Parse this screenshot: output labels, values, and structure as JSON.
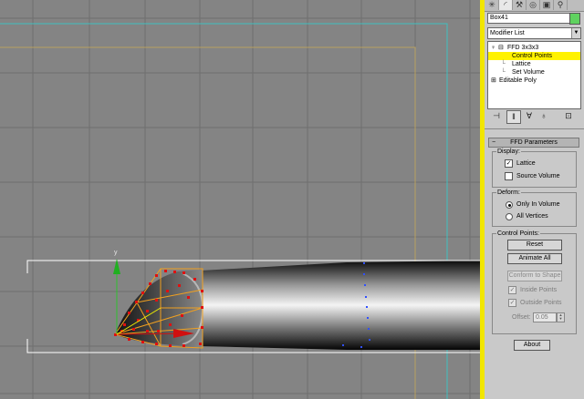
{
  "viewport": {
    "gizmo_axis_label": "y"
  },
  "command_panel": {
    "tabs": [
      {
        "icon": "create-icon",
        "glyph": "✳"
      },
      {
        "icon": "modify-icon",
        "glyph": "◜"
      },
      {
        "icon": "hierarchy-icon",
        "glyph": "⚒"
      },
      {
        "icon": "motion-icon",
        "glyph": "◎"
      },
      {
        "icon": "display-icon",
        "glyph": "▣"
      },
      {
        "icon": "utilities-icon",
        "glyph": "⚲"
      }
    ],
    "object_name": "Box41",
    "object_color": "#5fd25f",
    "modifier_list_label": "Modifier List",
    "stack": {
      "items": [
        {
          "label": "FFD 3x3x3",
          "selected": false
        },
        {
          "label": "Control Points",
          "selected": true
        },
        {
          "label": "Lattice",
          "selected": false
        },
        {
          "label": "Set Volume",
          "selected": false
        },
        {
          "label": "Editable Poly",
          "selected": false
        }
      ]
    },
    "stack_toolbar": [
      "pin-stack-icon",
      "show-end-result-icon",
      "make-unique-icon",
      "remove-modifier-icon",
      "configure-sets-icon"
    ],
    "ffd": {
      "title": "FFD Parameters",
      "display_label": "Display:",
      "lattice_label": "Lattice",
      "lattice_checked": true,
      "source_volume_label": "Source Volume",
      "source_volume_checked": false,
      "deform_label": "Deform:",
      "only_in_volume_label": "Only In Volume",
      "all_vertices_label": "All Vertices",
      "deform_mode": "only_in_volume",
      "control_points_label": "Control Points:",
      "reset_label": "Reset",
      "animate_all_label": "Animate All",
      "conform_label": "Conform to Shape",
      "inside_points_label": "Inside Points",
      "inside_points_checked": true,
      "outside_points_label": "Outside Points",
      "outside_points_checked": true,
      "offset_label": "Offset:",
      "offset_value": "0.05",
      "about_label": "About"
    }
  },
  "colors": {
    "viewport_bg": "#848484",
    "active_border": "#f2e600",
    "selection_highlight": "#fff200",
    "lattice": "#f0a020",
    "control_point": "#e01010"
  }
}
